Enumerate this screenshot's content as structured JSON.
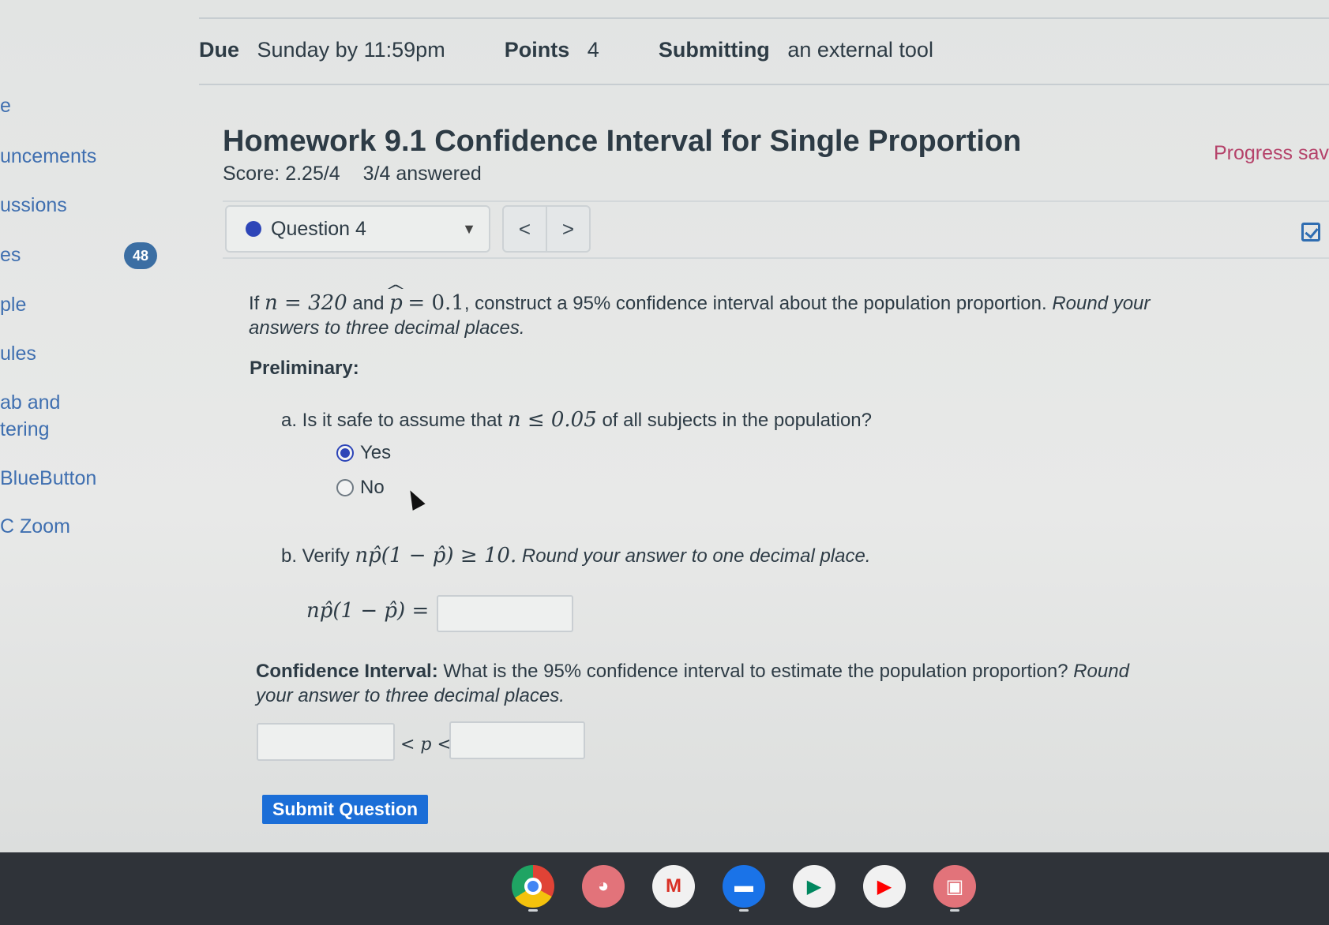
{
  "assignment_meta": {
    "due_label": "Due",
    "due_value": "Sunday by 11:59pm",
    "points_label": "Points",
    "points_value": "4",
    "submitting_label": "Submitting",
    "submitting_value": "an external tool"
  },
  "sidebar": {
    "items": [
      {
        "label": "e"
      },
      {
        "label": "uncements"
      },
      {
        "label": "ussions"
      },
      {
        "label": "es"
      },
      {
        "label": "ple"
      },
      {
        "label": "ules"
      },
      {
        "label": "ab and"
      },
      {
        "label": "tering"
      },
      {
        "label": "BlueButton"
      },
      {
        "label": "C Zoom"
      }
    ],
    "badge": "48"
  },
  "homework": {
    "title": "Homework 9.1 Confidence Interval for Single Proportion",
    "score": "Score: 2.25/4",
    "answered": "3/4 answered",
    "progress": "Progress saved"
  },
  "question_nav": {
    "selected": "Question 4",
    "prev": "<",
    "next": ">"
  },
  "question": {
    "prompt_if": "If",
    "prompt_n": "n = 320",
    "prompt_and": "and",
    "prompt_phat": "p",
    "prompt_phat_val": "= 0.1",
    "prompt_rest": ", construct a 95% confidence interval about the population proportion.",
    "prompt_italic": "Round your answers to three decimal places.",
    "preliminary": "Preliminary:",
    "part_a_pre": "a. Is it safe to assume that",
    "part_a_math": "n ≤ 0.05",
    "part_a_post": "of all subjects in the population?",
    "option_yes": "Yes",
    "option_no": "No",
    "part_b_pre": "b. Verify",
    "part_b_math": "np̂(1 − p̂) ≥ 10.",
    "part_b_italic": "Round your answer to one decimal place.",
    "part_b_lhs": "np̂(1 − p̂) =",
    "ci_label": "Confidence Interval:",
    "ci_text": "What is the 95% confidence interval to estimate the population proportion?",
    "ci_italic": "Round your answer to three decimal places.",
    "ci_middle": "< p <",
    "submit": "Submit Question"
  },
  "shelf": {
    "apps": [
      "chrome-icon",
      "palette-icon",
      "gmail-icon",
      "files-icon",
      "play-store-icon",
      "youtube-icon",
      "screencast-icon"
    ]
  }
}
